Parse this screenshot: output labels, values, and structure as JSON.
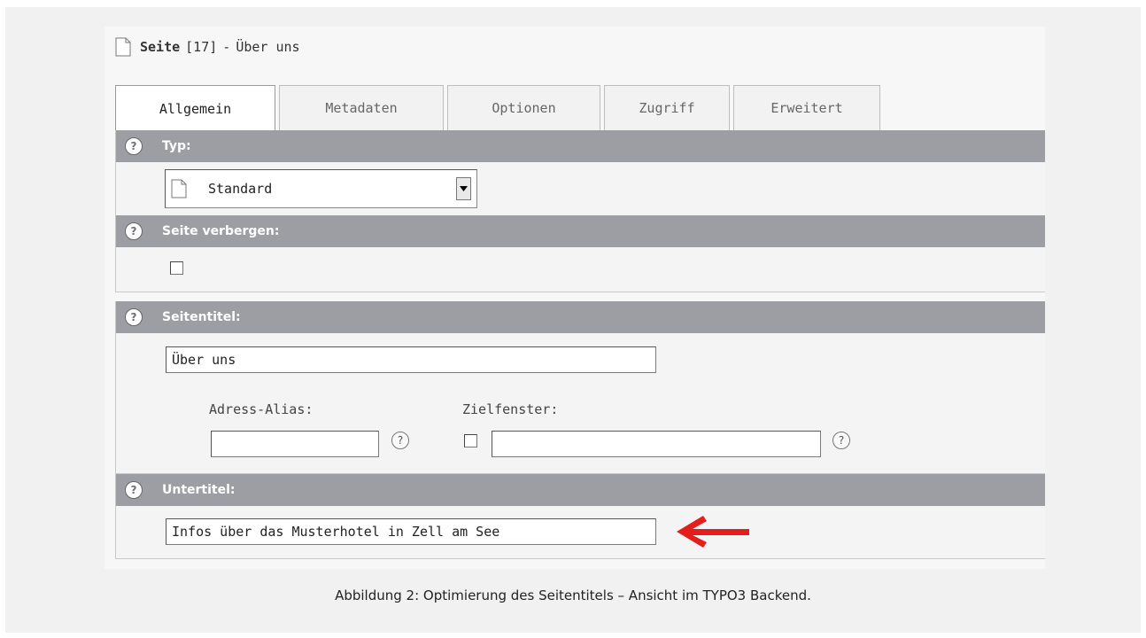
{
  "header": {
    "label": "Seite",
    "id": "[17]",
    "separator": "-",
    "title": "Über uns"
  },
  "tabs": [
    {
      "label": "Allgemein"
    },
    {
      "label": "Metadaten"
    },
    {
      "label": "Optionen"
    },
    {
      "label": "Zugriff"
    },
    {
      "label": "Erweitert"
    }
  ],
  "sections": {
    "typ": {
      "title": "Typ:",
      "select_value": "Standard"
    },
    "hide": {
      "title": "Seite verbergen:"
    },
    "seitentitel": {
      "title": "Seitentitel:",
      "value": "Über uns",
      "alias_label": "Adress-Alias:",
      "alias_value": "",
      "target_label": "Zielfenster:",
      "target_value": ""
    },
    "untertitel": {
      "title": "Untertitel:",
      "value": "Infos über das Musterhotel in Zell am See"
    }
  },
  "help_glyph": "?",
  "arrow_color": "#e41d1d",
  "section_header_color": "#9c9ea3",
  "caption": "Abbildung 2: Optimierung des Seitentitels – Ansicht im TYPO3 Backend."
}
